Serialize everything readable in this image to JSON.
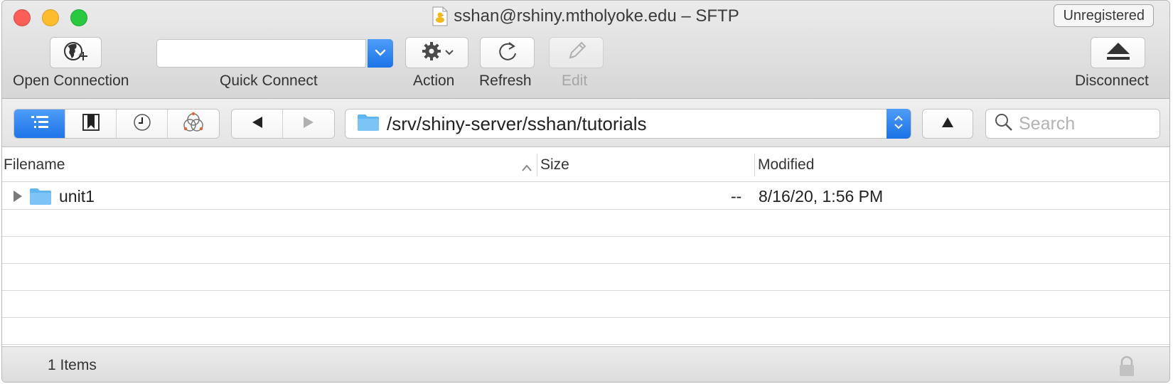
{
  "window": {
    "title": "sshan@rshiny.mtholyoke.edu – SFTP",
    "unregistered_label": "Unregistered"
  },
  "toolbar": {
    "open_connection": "Open Connection",
    "quick_connect": "Quick Connect",
    "quick_connect_value": "",
    "action": "Action",
    "refresh": "Refresh",
    "edit": "Edit",
    "disconnect": "Disconnect"
  },
  "navigation": {
    "path": "/srv/shiny-server/sshan/tutorials",
    "search_placeholder": "Search",
    "view_modes": [
      "browser-icon",
      "bookmarks-icon",
      "history-icon",
      "bonjour-icon"
    ],
    "active_view": "browser-icon"
  },
  "table": {
    "columns": [
      "Filename",
      "Size",
      "Modified"
    ],
    "sort_column": "Filename",
    "rows": [
      {
        "name": "unit1",
        "type": "folder",
        "size": "--",
        "modified": "8/16/20, 1:56 PM"
      }
    ]
  },
  "status": {
    "items_label": "1 Items"
  },
  "colors": {
    "accent": "#1a73e8",
    "folder": "#7cc4f5",
    "close": "#fc5f57",
    "minimize": "#fdbc2e",
    "maximize": "#28c840"
  }
}
